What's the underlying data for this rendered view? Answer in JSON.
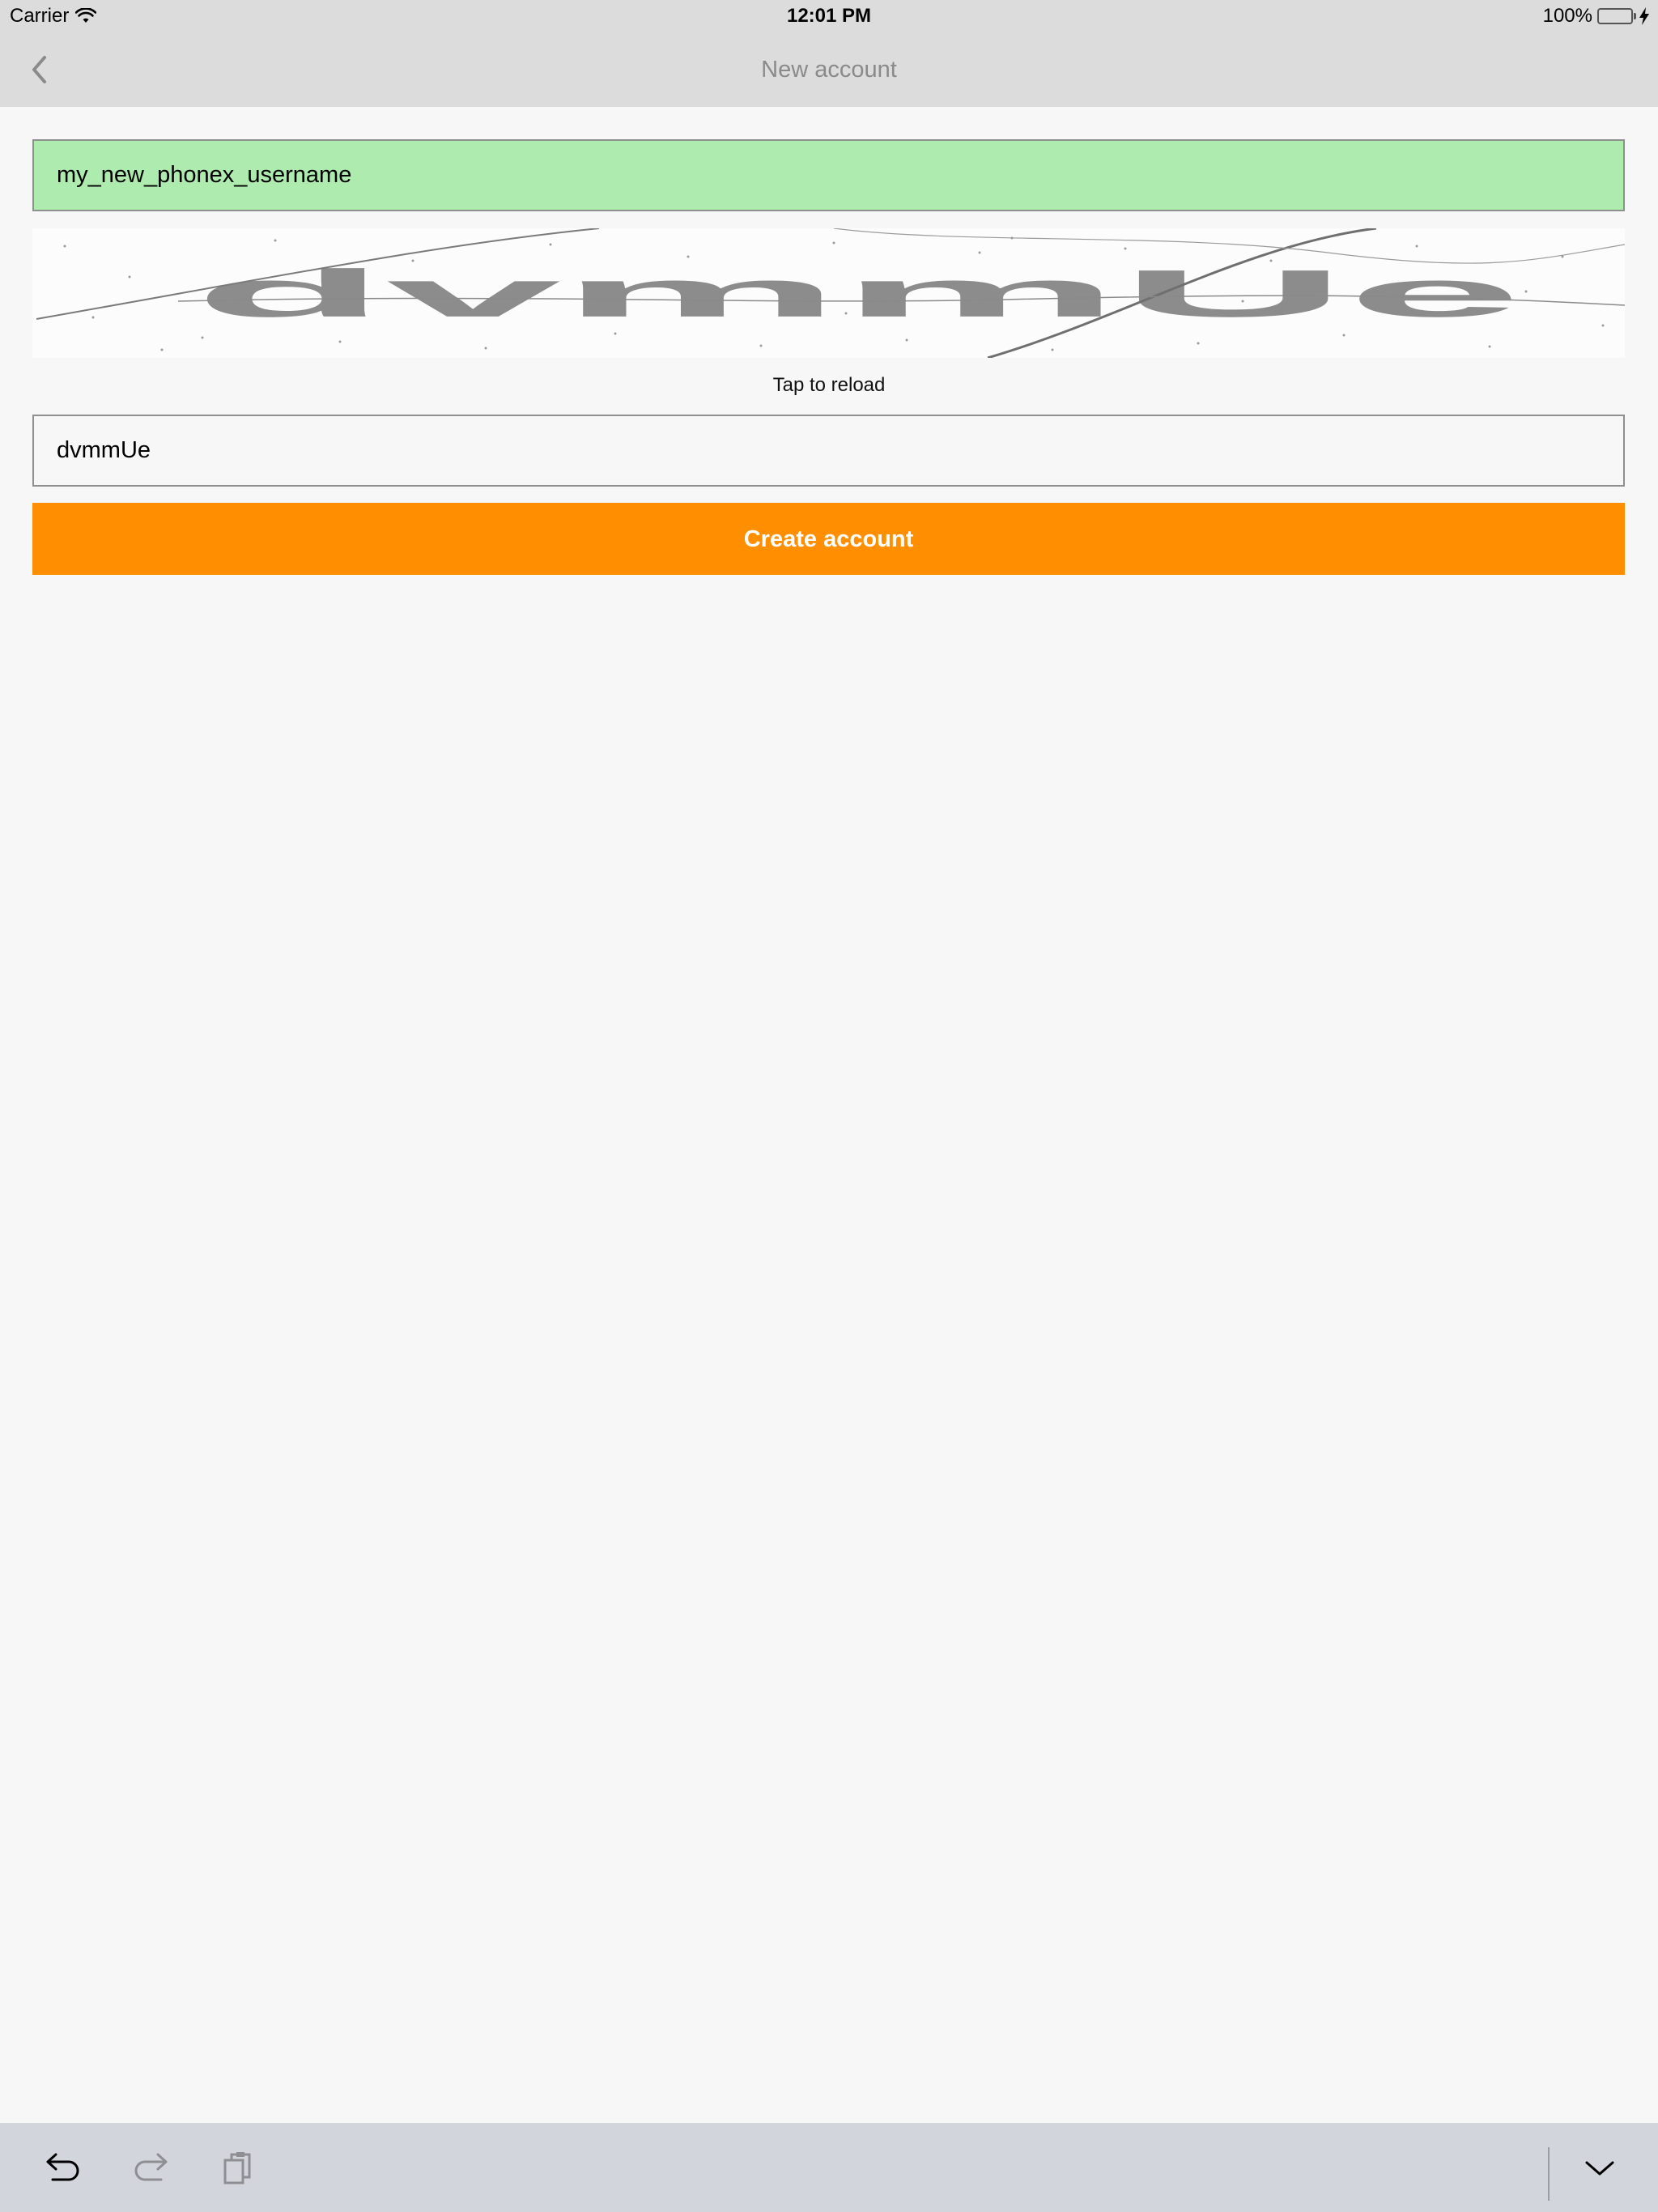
{
  "status_bar": {
    "carrier": "Carrier",
    "time": "12:01 PM",
    "battery": "100%",
    "battery_color": "#4cd964"
  },
  "nav": {
    "back_icon": "chevron-left-icon",
    "title": "New account"
  },
  "form": {
    "username_value": "my_new_phonex_username",
    "username_bg": "#aeebae",
    "captcha_image_text": "dvmmUe",
    "captcha_hint": "Tap to reload",
    "captcha_value": "dvmmUe",
    "create_label": "Create account",
    "accent": "#ff8f00"
  },
  "shortcut_bar": {
    "icons": [
      "undo-icon",
      "redo-icon",
      "paste-icon",
      "hide-keyboard-icon"
    ]
  }
}
